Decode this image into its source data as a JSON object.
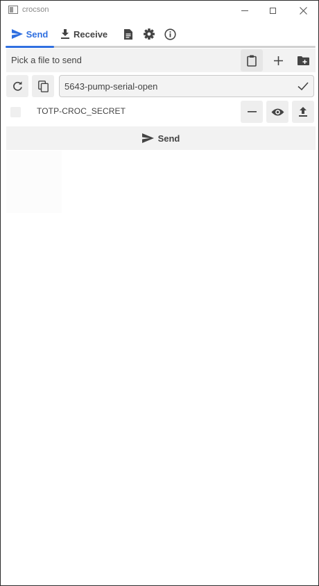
{
  "window": {
    "title": "crocson",
    "minimize_icon": "minimize-icon",
    "maximize_icon": "maximize-icon",
    "close_icon": "close-icon"
  },
  "tabs": {
    "send": {
      "label": "Send",
      "icon": "send-icon",
      "active": true
    },
    "receive": {
      "label": "Receive",
      "icon": "download-icon"
    },
    "docs": {
      "icon": "document-icon"
    },
    "settings": {
      "icon": "gear-icon"
    },
    "about": {
      "icon": "info-icon"
    },
    "accent_color": "#2f6fe0"
  },
  "pick_row": {
    "label": "Pick a file to send",
    "buttons": [
      "clipboard-icon",
      "plus-icon",
      "add-folder-icon"
    ]
  },
  "code_row": {
    "code_value": "5643-pump-serial-open",
    "buttons": [
      "refresh-icon",
      "copy-icon",
      "check-icon"
    ]
  },
  "files": [
    {
      "name": "TOTP-CROC_SECRET",
      "checked": false,
      "actions": [
        "minus-icon",
        "eye-icon",
        "upload-icon"
      ]
    }
  ],
  "send_button": {
    "label": "Send",
    "icon": "send-icon"
  }
}
